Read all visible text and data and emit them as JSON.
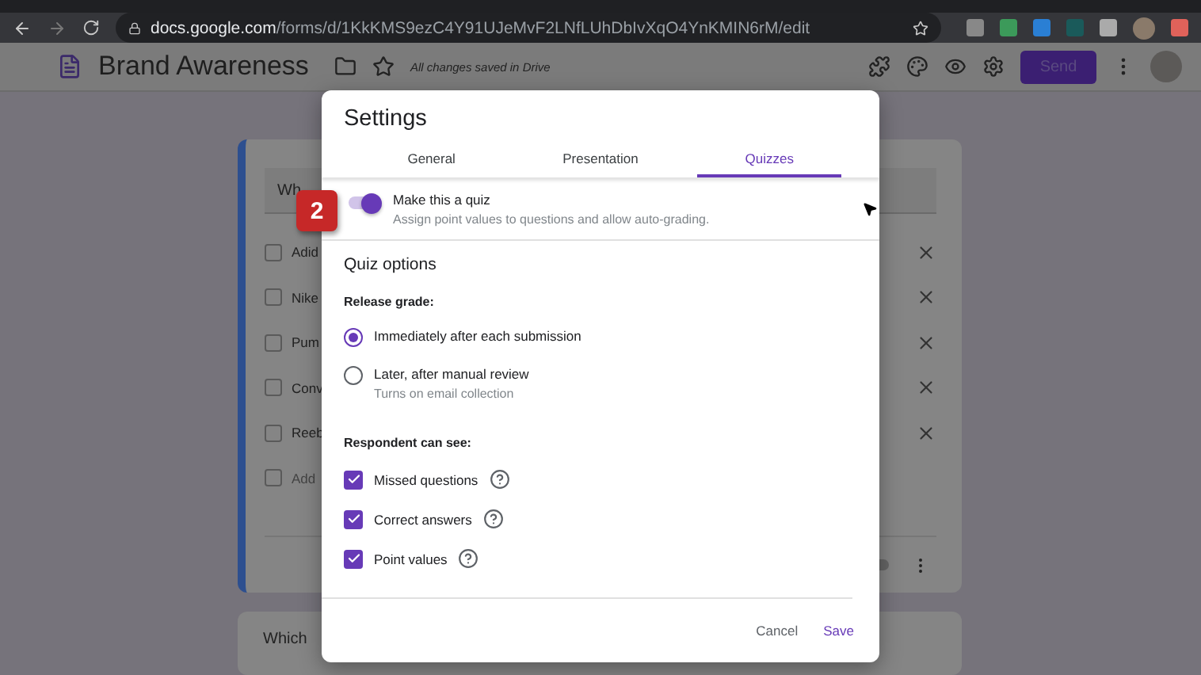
{
  "browser": {
    "url_host": "docs.google.com",
    "url_path": "/forms/d/1KkKMS9ezC4Y91UJeMvF2LNfLUhDbIvXqO4YnKMIN6rM/edit"
  },
  "header": {
    "title": "Brand Awareness",
    "save_status": "All changes saved in Drive",
    "send_label": "Send"
  },
  "form": {
    "question_title": "Wh",
    "options": [
      {
        "label": "Adid",
        "checked": false
      },
      {
        "label": "Nike",
        "checked": false
      },
      {
        "label": "Pum",
        "checked": false
      },
      {
        "label": "Conv",
        "checked": false
      },
      {
        "label": "Reeb",
        "checked": false
      }
    ],
    "add_option": "Add",
    "required_on": false,
    "next_question": "Which"
  },
  "dialog": {
    "title": "Settings",
    "tabs": [
      {
        "label": "General",
        "selected": false
      },
      {
        "label": "Presentation",
        "selected": false
      },
      {
        "label": "Quizzes",
        "selected": true
      }
    ],
    "quiz_toggle": {
      "label": "Make this a quiz",
      "description": "Assign point values to questions and allow auto-grading.",
      "on": true
    },
    "section_title": "Quiz options",
    "release": {
      "heading": "Release grade:",
      "options": [
        {
          "label": "Immediately after each submission",
          "selected": true
        },
        {
          "label": "Later, after manual review",
          "sub": "Turns on email collection",
          "selected": false
        }
      ]
    },
    "respondent": {
      "heading": "Respondent can see:",
      "items": [
        {
          "label": "Missed questions",
          "checked": true
        },
        {
          "label": "Correct answers",
          "checked": true
        },
        {
          "label": "Point values",
          "checked": true
        }
      ]
    },
    "buttons": [
      {
        "label": "Cancel",
        "kind": "text"
      },
      {
        "label": "Save",
        "kind": "primary"
      }
    ]
  },
  "callout": {
    "label": "2"
  }
}
